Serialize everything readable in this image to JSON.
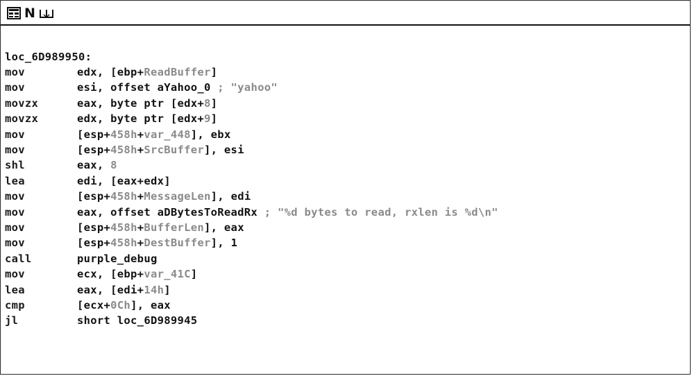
{
  "toolbar": {
    "graph_icon": "graph-view-icon",
    "n_label": "N",
    "tree_icon": "tree-view-icon"
  },
  "listing": {
    "label": "loc_6D989950:",
    "instructions": [
      {
        "mnemonic": "mov",
        "p1": "edx, [ebp+",
        "g1": "ReadBuffer",
        "p2": "]",
        "g2": "",
        "p3": ""
      },
      {
        "mnemonic": "mov",
        "p1": "esi, offset aYahoo_0 ",
        "g1": "; \"yahoo\"",
        "p2": "",
        "g2": "",
        "p3": ""
      },
      {
        "mnemonic": "movzx",
        "p1": "eax, byte ptr [edx+",
        "g1": "8",
        "p2": "]",
        "g2": "",
        "p3": ""
      },
      {
        "mnemonic": "movzx",
        "p1": "edx, byte ptr [edx+",
        "g1": "9",
        "p2": "]",
        "g2": "",
        "p3": ""
      },
      {
        "mnemonic": "mov",
        "p1": "[esp+",
        "g1": "458h",
        "p2": "+",
        "g2": "var_448",
        "p3": "], ebx"
      },
      {
        "mnemonic": "mov",
        "p1": "[esp+",
        "g1": "458h",
        "p2": "+",
        "g2": "SrcBuffer",
        "p3": "], esi"
      },
      {
        "mnemonic": "shl",
        "p1": "eax, ",
        "g1": "8",
        "p2": "",
        "g2": "",
        "p3": ""
      },
      {
        "mnemonic": "lea",
        "p1": "edi, [eax+edx]",
        "g1": "",
        "p2": "",
        "g2": "",
        "p3": ""
      },
      {
        "mnemonic": "mov",
        "p1": "[esp+",
        "g1": "458h",
        "p2": "+",
        "g2": "MessageLen",
        "p3": "], edi"
      },
      {
        "mnemonic": "mov",
        "p1": "eax, offset aDBytesToReadRx ",
        "g1": "; \"%d bytes to read, rxlen is %d\\n\"",
        "p2": "",
        "g2": "",
        "p3": ""
      },
      {
        "mnemonic": "mov",
        "p1": "[esp+",
        "g1": "458h",
        "p2": "+",
        "g2": "BufferLen",
        "p3": "], eax"
      },
      {
        "mnemonic": "mov",
        "p1": "[esp+",
        "g1": "458h",
        "p2": "+",
        "g2": "DestBuffer",
        "p3": "], 1"
      },
      {
        "mnemonic": "call",
        "p1": "purple_debug",
        "g1": "",
        "p2": "",
        "g2": "",
        "p3": ""
      },
      {
        "mnemonic": "mov",
        "p1": "ecx, [ebp+",
        "g1": "var_41C",
        "p2": "]",
        "g2": "",
        "p3": ""
      },
      {
        "mnemonic": "lea",
        "p1": "eax, [edi+",
        "g1": "14h",
        "p2": "]",
        "g2": "",
        "p3": ""
      },
      {
        "mnemonic": "cmp",
        "p1": "[ecx+",
        "g1": "0Ch",
        "p2": "], eax",
        "g2": "",
        "p3": ""
      },
      {
        "mnemonic": "jl",
        "p1": "short loc_6D989945",
        "g1": "",
        "p2": "",
        "g2": "",
        "p3": ""
      }
    ]
  }
}
